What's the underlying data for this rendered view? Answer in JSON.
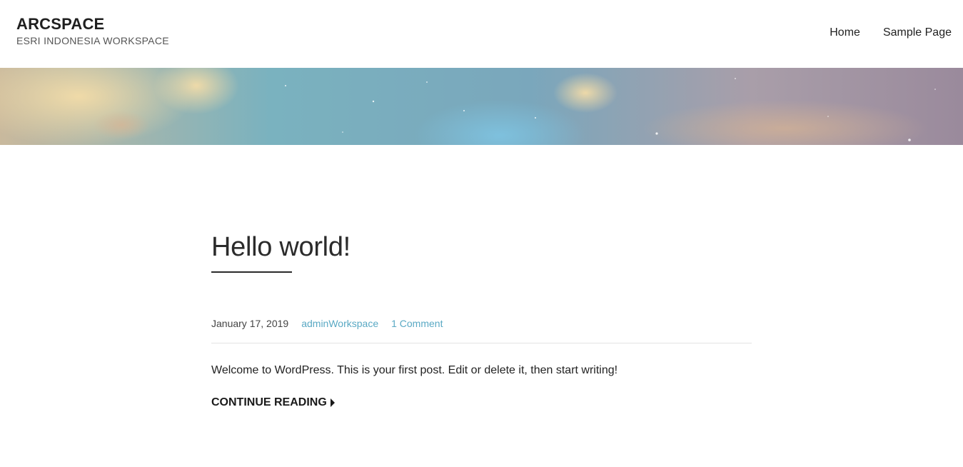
{
  "site": {
    "title": "ARCSPACE",
    "description": "ESRI INDONESIA WORKSPACE"
  },
  "nav": {
    "items": [
      {
        "label": "Home"
      },
      {
        "label": "Sample Page"
      }
    ]
  },
  "post": {
    "title": "Hello world!",
    "date": "January 17, 2019",
    "author": "adminWorkspace",
    "comments": "1 Comment",
    "excerpt": "Welcome to WordPress. This is your first post. Edit or delete it, then start writing!",
    "continue_label": "CONTINUE READING"
  },
  "colors": {
    "link": "#5aa9c4",
    "text": "#222222",
    "rule": "#e3e3e3"
  }
}
